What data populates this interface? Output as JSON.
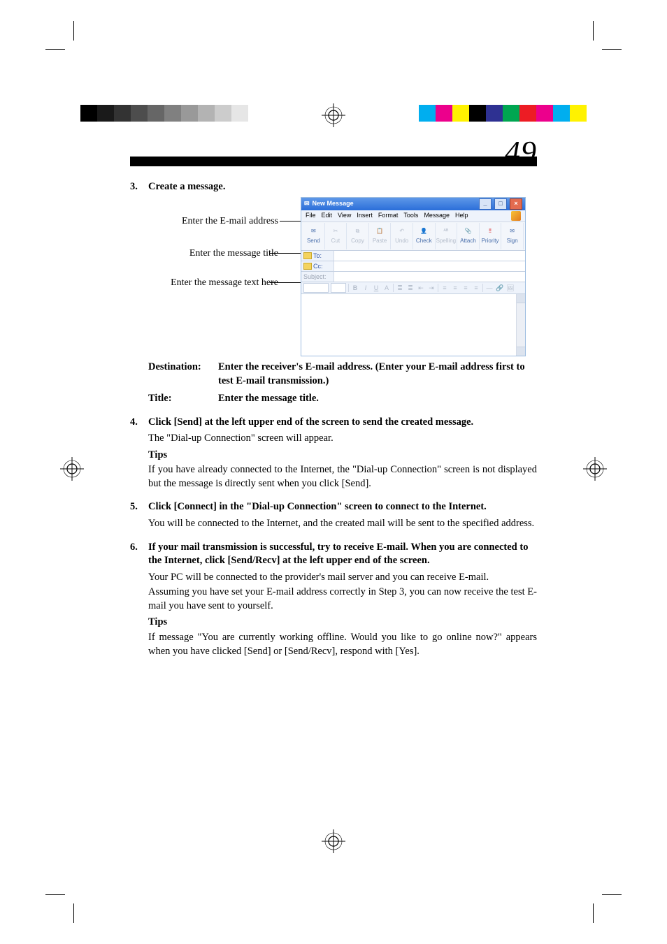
{
  "page_number": "49",
  "color_bars": {
    "left_grays": [
      "#000000",
      "#1a1a1a",
      "#333333",
      "#4d4d4d",
      "#666666",
      "#808080",
      "#999999",
      "#b3b3b3",
      "#cccccc",
      "#e6e6e6",
      "#ffffff"
    ],
    "right_colors": [
      "#00aeef",
      "#ec008c",
      "#fff200",
      "#000000",
      "#2e3192",
      "#00a651",
      "#ed1c24",
      "#ec008c",
      "#00aeef",
      "#fff200"
    ]
  },
  "step3": {
    "num": "3.",
    "title": "Create a message.",
    "ann1": "Enter the E-mail address",
    "ann2": "Enter the message title",
    "ann3": "Enter the message text here",
    "def_dest_label": "Destination:",
    "def_dest_text": "Enter the receiver's E-mail address.  (Enter your E-mail address first to test E-mail transmission.)",
    "def_title_label": "Title:",
    "def_title_text": "Enter the message title."
  },
  "step4": {
    "num": "4.",
    "title": "Click [Send] at the left upper end of the screen to send the created message.",
    "p1": "The \"Dial-up Connection\" screen will appear.",
    "tips_label": "Tips",
    "tips": "If you have already connected to the Internet, the \"Dial-up Connection\" screen is not displayed but the message is directly sent when you click [Send]."
  },
  "step5": {
    "num": "5.",
    "title": "Click [Connect] in the \"Dial-up Connection\" screen to connect to the Internet.",
    "p1": "You will be connected to the Internet, and the created mail will be sent to the specified address."
  },
  "step6": {
    "num": "6.",
    "title": "If your mail transmission is successful, try to receive E-mail.  When you are connected to the Internet, click [Send/Recv] at the left upper end of the screen.",
    "p1": "Your PC will be connected to the provider's mail server and you can receive E-mail.",
    "p2": "Assuming you have set your E-mail address correctly in Step 3, you can now receive the test E-mail you have sent to yourself.",
    "tips_label": "Tips",
    "tips": "If message \"You are currently working offline. Would you like to go online now?\" appears when you have clicked [Send] or [Send/Recv], respond with [Yes]."
  },
  "outlook_window": {
    "title": "New Message",
    "menus": {
      "file": "File",
      "edit": "Edit",
      "view": "View",
      "insert": "Insert",
      "format": "Format",
      "tools": "Tools",
      "message": "Message",
      "help": "Help"
    },
    "tools": {
      "send": "Send",
      "cut": "Cut",
      "copy": "Copy",
      "paste": "Paste",
      "undo": "Undo",
      "check": "Check",
      "spelling": "Spelling",
      "attach": "Attach",
      "priority": "Priority",
      "sign": "Sign"
    },
    "addr": {
      "to": "To:",
      "cc": "Cc:",
      "subject": "Subject:"
    },
    "winbtns": {
      "min": "_",
      "max": "□",
      "close": "×"
    }
  }
}
